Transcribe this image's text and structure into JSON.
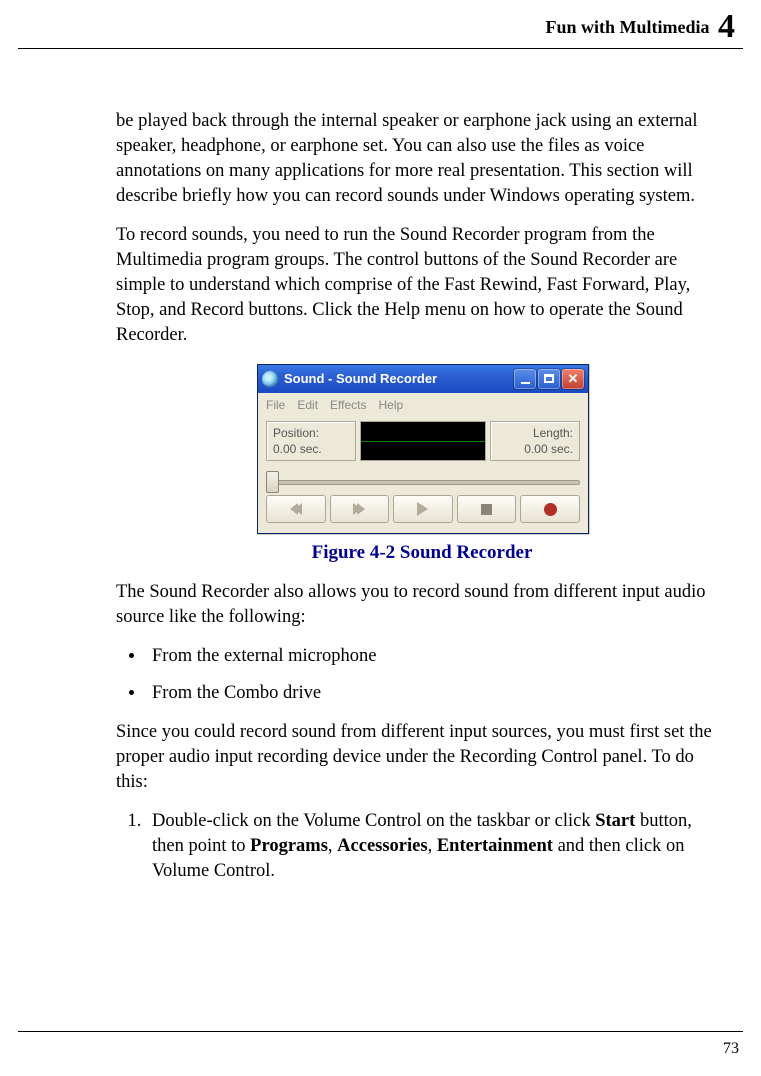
{
  "header": {
    "title": "Fun with Multimedia",
    "chapter_number": "4"
  },
  "para1": "be played back through the internal speaker or earphone jack using an external speaker, headphone, or earphone set. You can also use the files as voice annotations on many applications for more real presentation. This section will describe briefly how you can record sounds under Windows operating system.",
  "para2": "To record sounds, you need to run the Sound Recorder program from the Multimedia program groups. The control buttons of the Sound Recorder are simple to understand which comprise of the Fast Rewind, Fast Forward, Play, Stop, and Record buttons. Click the Help menu on how to operate the Sound Recorder.",
  "sound_recorder": {
    "window_title": "Sound - Sound Recorder",
    "menu": {
      "file": "File",
      "edit": "Edit",
      "effects": "Effects",
      "help": "Help"
    },
    "position_label": "Position:",
    "position_value": "0.00 sec.",
    "length_label": "Length:",
    "length_value": "0.00 sec.",
    "close_glyph": "✕"
  },
  "figure_caption": "Figure 4-2    Sound Recorder",
  "para3": "The Sound Recorder also allows you to record sound from different input audio source like the following:",
  "bullets": {
    "b1": "From the external microphone",
    "b2": "From the Combo drive"
  },
  "para4": "Since you could record sound from different input sources, you must first set the proper audio input recording device under the Recording Control panel. To do this:",
  "step1": {
    "pre": "Double-click on the Volume Control on the taskbar or click ",
    "s1": "Start",
    "mid1": " button, then point to ",
    "s2": "Programs",
    "sep": ", ",
    "s3": "Accessories",
    "s4": "Entertainment",
    "mid2": " and then click on Volume Control."
  },
  "page_number": "73"
}
